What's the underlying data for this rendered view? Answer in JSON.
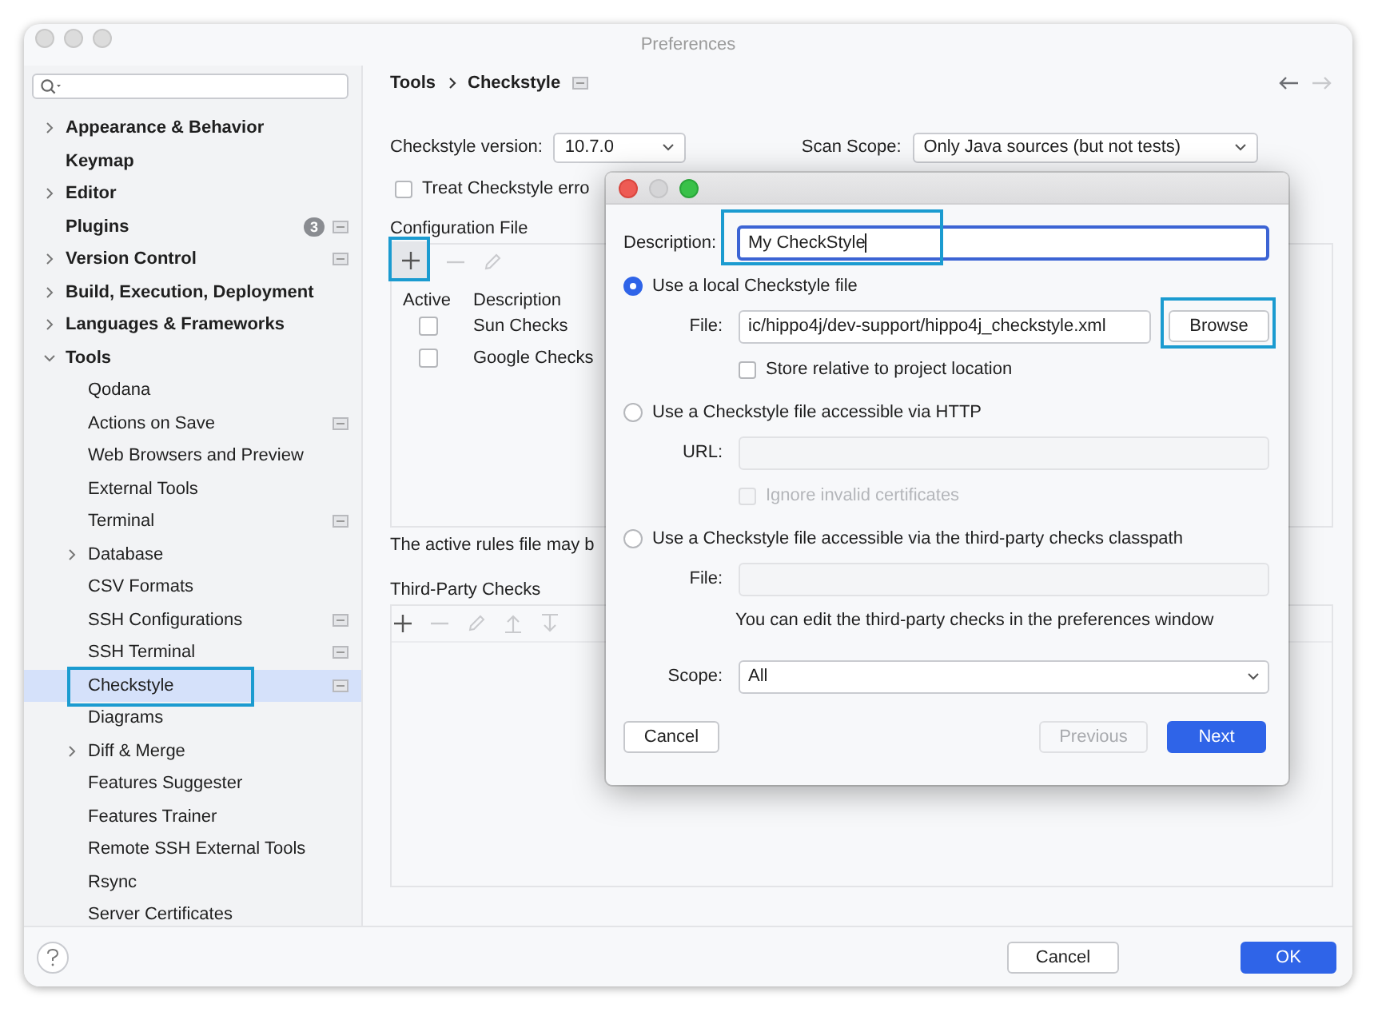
{
  "window": {
    "title": "Preferences"
  },
  "search": {
    "has_dropdown": true
  },
  "sidebar": {
    "items": [
      {
        "label": "Appearance & Behavior",
        "expanded": false,
        "selected": false
      },
      {
        "label": "Keymap",
        "selected": false
      },
      {
        "label": "Editor",
        "expanded": false,
        "selected": false
      },
      {
        "label": "Plugins",
        "badge": "3",
        "project_level": true,
        "selected": false
      },
      {
        "label": "Version Control",
        "expanded": false,
        "project_level": true,
        "selected": false
      },
      {
        "label": "Build, Execution, Deployment",
        "expanded": false,
        "selected": false
      },
      {
        "label": "Languages & Frameworks",
        "expanded": false,
        "selected": false
      },
      {
        "label": "Tools",
        "expanded": true,
        "selected": false,
        "children": [
          {
            "label": "Qodana",
            "selected": false
          },
          {
            "label": "Actions on Save",
            "project_level": true,
            "selected": false
          },
          {
            "label": "Web Browsers and Preview",
            "selected": false
          },
          {
            "label": "External Tools",
            "selected": false
          },
          {
            "label": "Terminal",
            "project_level": true,
            "selected": false
          },
          {
            "label": "Database",
            "expanded": false,
            "selected": false
          },
          {
            "label": "CSV Formats",
            "selected": false
          },
          {
            "label": "SSH Configurations",
            "project_level": true,
            "selected": false
          },
          {
            "label": "SSH Terminal",
            "project_level": true,
            "selected": false
          },
          {
            "label": "Checkstyle",
            "project_level": true,
            "selected": true,
            "annotated": true
          },
          {
            "label": "Diagrams",
            "selected": false
          },
          {
            "label": "Diff & Merge",
            "expanded": false,
            "selected": false
          },
          {
            "label": "Features Suggester",
            "selected": false
          },
          {
            "label": "Features Trainer",
            "selected": false
          },
          {
            "label": "Remote SSH External Tools",
            "selected": false
          },
          {
            "label": "Rsync",
            "selected": false
          },
          {
            "label": "Server Certificates",
            "selected": false
          }
        ]
      }
    ]
  },
  "breadcrumb": [
    "Tools",
    "Checkstyle"
  ],
  "nav": {
    "back_disabled": false,
    "forward_disabled": true
  },
  "settings": {
    "version_label": "Checkstyle version:",
    "version": "10.7.0",
    "scope_label": "Scan Scope:",
    "scope": "Only Java sources (but not tests)",
    "treat_errors": {
      "label": "Treat Checkstyle erro",
      "checked": false
    }
  },
  "config": {
    "title": "Configuration File",
    "add_annotated": true,
    "columns": [
      "Active",
      "Description"
    ],
    "rows": [
      {
        "description": "Sun Checks",
        "active": false
      },
      {
        "description": "Google Checks",
        "active": false
      }
    ],
    "note": "The active rules file may b"
  },
  "third_party": {
    "title": "Third-Party Checks"
  },
  "dialog": {
    "description_label": "Description:",
    "description": "My CheckStyle",
    "description_annotated": true,
    "options": [
      {
        "label": "Use a local Checkstyle file",
        "selected": true
      },
      {
        "label": "Use a Checkstyle file accessible via HTTP",
        "selected": false
      },
      {
        "label": "Use a Checkstyle file accessible via the third-party checks classpath",
        "selected": false
      }
    ],
    "file_label": "File:",
    "file": "ic/hippo4j/dev-support/hippo4j_checkstyle.xml",
    "browse": "Browse",
    "browse_annotated": true,
    "store_relative": {
      "label": "Store relative to project location",
      "checked": false
    },
    "url_label": "URL:",
    "ignore_certs": {
      "label": "Ignore invalid certificates",
      "checked": false,
      "disabled": true
    },
    "classpath_file_label": "File:",
    "classpath_note": "You can edit the third-party checks in the preferences window",
    "scope_label": "Scope:",
    "scope": "All",
    "buttons": [
      {
        "label": "Cancel",
        "kind": "plain",
        "disabled": false
      },
      {
        "label": "Previous",
        "kind": "plain",
        "disabled": true
      },
      {
        "label": "Next",
        "kind": "primary",
        "disabled": false
      }
    ]
  },
  "footer": {
    "buttons": [
      {
        "label": "Cancel",
        "kind": "plain"
      },
      {
        "label": "OK",
        "kind": "primary"
      }
    ]
  }
}
